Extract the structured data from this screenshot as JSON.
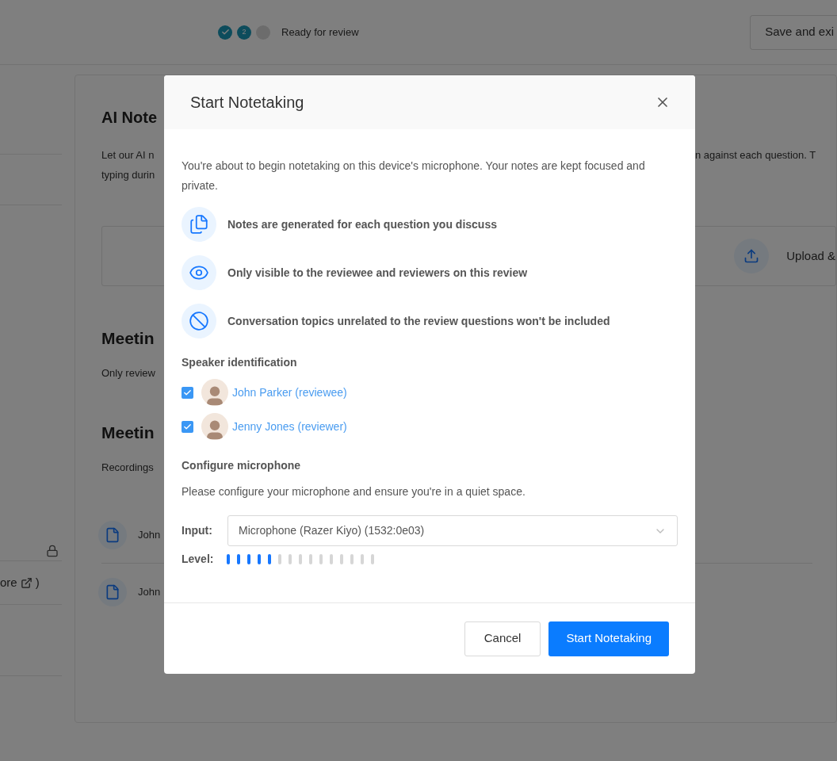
{
  "header": {
    "steps": [
      {
        "kind": "done"
      },
      {
        "kind": "current",
        "label": "2"
      },
      {
        "kind": "todo"
      }
    ],
    "step_label": "Ready for review",
    "save_button": "Save and exi"
  },
  "sidebar": {
    "link": "ore",
    "link_end": ")"
  },
  "card": {
    "title": "AI Note",
    "description_lines": [
      "Let our AI n",
      "typing durin"
    ],
    "description_right": "n against each question. T",
    "upload_label": "Upload &",
    "sections": [
      {
        "title": "Meetin",
        "text": "Only review"
      },
      {
        "title": "Meetin",
        "text": "Recordings"
      }
    ],
    "files": [
      "John",
      "John"
    ]
  },
  "modal": {
    "title": "Start Notetaking",
    "intro": "You're about to begin notetaking on this device's microphone. Your notes are kept focused and private.",
    "features": [
      {
        "kind": "copy",
        "text": "Notes are generated for each question you discuss"
      },
      {
        "kind": "eye",
        "text": "Only visible to the reviewee and reviewers on this review"
      },
      {
        "kind": "block",
        "text": "Conversation topics unrelated to the review questions won't be included"
      }
    ],
    "speaker_title": "Speaker identification",
    "speakers": [
      {
        "name": "John Parker (reviewee)",
        "checked": true
      },
      {
        "name": "Jenny Jones (reviewer)",
        "checked": true
      }
    ],
    "mic_title": "Configure microphone",
    "mic_text": "Please configure your microphone and ensure you're in a quiet space.",
    "input_label": "Input:",
    "input_value": "Microphone (Razer Kiyo) (1532:0e03)",
    "level_label": "Level:",
    "level": 0.333,
    "cancel": "Cancel",
    "start": "Start Notetaking"
  }
}
